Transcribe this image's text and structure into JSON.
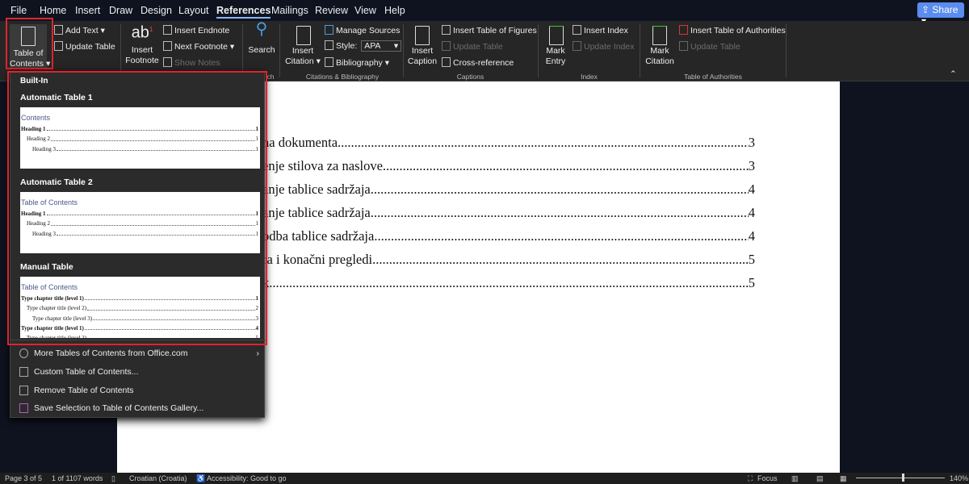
{
  "menu": {
    "tabs": [
      "File",
      "Home",
      "Insert",
      "Draw",
      "Design",
      "Layout",
      "References",
      "Mailings",
      "Review",
      "View",
      "Help"
    ],
    "active": "References",
    "share": "Share"
  },
  "ribbon": {
    "toc": {
      "label1": "Table of",
      "label2": "Contents ▾",
      "add_text": "Add Text ▾",
      "update_table": "Update Table"
    },
    "footnotes": {
      "insert_footnote1": "Insert",
      "insert_footnote2": "Footnote",
      "insert_endnote": "Insert Endnote",
      "next_footnote": "Next Footnote ▾",
      "show_notes": "Show Notes"
    },
    "research": {
      "search": "Search",
      "group": "ch"
    },
    "citations": {
      "insert_citation1": "Insert",
      "insert_citation2": "Citation ▾",
      "manage_sources": "Manage Sources",
      "style_label": "Style:",
      "style_value": "APA",
      "bibliography": "Bibliography ▾",
      "group": "Citations & Bibliography"
    },
    "captions": {
      "insert_caption1": "Insert",
      "insert_caption2": "Caption",
      "insert_tof": "Insert Table of Figures",
      "update_table": "Update Table",
      "cross_reference": "Cross-reference",
      "group": "Captions"
    },
    "index": {
      "mark_entry1": "Mark",
      "mark_entry2": "Entry",
      "insert_index": "Insert Index",
      "update_index": "Update Index",
      "group": "Index"
    },
    "authorities": {
      "mark_citation1": "Mark",
      "mark_citation2": "Citation",
      "insert_toa": "Insert Table of Authorities",
      "update_table": "Update Table",
      "group": "Table of Authorities"
    }
  },
  "dropdown": {
    "section": "Built-In",
    "items": [
      {
        "title": "Automatic Table 1",
        "heading": "Contents",
        "lines": [
          [
            "Heading 1",
            "1"
          ],
          [
            "Heading 2",
            "1"
          ],
          [
            "Heading 3",
            "1"
          ]
        ]
      },
      {
        "title": "Automatic Table 2",
        "heading": "Table of Contents",
        "lines": [
          [
            "Heading 1",
            "1"
          ],
          [
            "Heading 2",
            "1"
          ],
          [
            "Heading 3",
            "1"
          ]
        ]
      },
      {
        "title": "Manual Table",
        "heading": "Table of Contents",
        "lines": [
          [
            "Type chapter title (level 1)",
            "1"
          ],
          [
            "Type chapter title (level 2)",
            "2"
          ],
          [
            "Type chapter title (level 3)",
            "3"
          ],
          [
            "Type chapter title (level 1)",
            "4"
          ],
          [
            "Type chapter title (level 2)",
            "5"
          ]
        ]
      }
    ],
    "menu": [
      "More Tables of Contents from Office.com",
      "Custom Table of Contents...",
      "Remove Table of Contents",
      "Save Selection to Table of Contents Gallery..."
    ]
  },
  "document": {
    "toc": [
      [
        "na dokumenta",
        "3"
      ],
      [
        "enje stilova za naslove",
        "3"
      ],
      [
        "anje tablice sadržaja",
        "4"
      ],
      [
        "anje tablice sadržaja",
        "4"
      ],
      [
        "odba tablice sadržaja",
        "4"
      ],
      [
        "ra i konačni pregledi",
        "5"
      ],
      [
        "k",
        "5"
      ]
    ]
  },
  "status": {
    "page": "Page 3 of 5",
    "words": "1 of 1107 words",
    "language": "Croatian (Croatia)",
    "accessibility": "Accessibility: Good to go",
    "focus": "Focus",
    "zoom": "140%"
  },
  "colors": {
    "highlight": "#e0242c",
    "share": "#5b8def"
  }
}
